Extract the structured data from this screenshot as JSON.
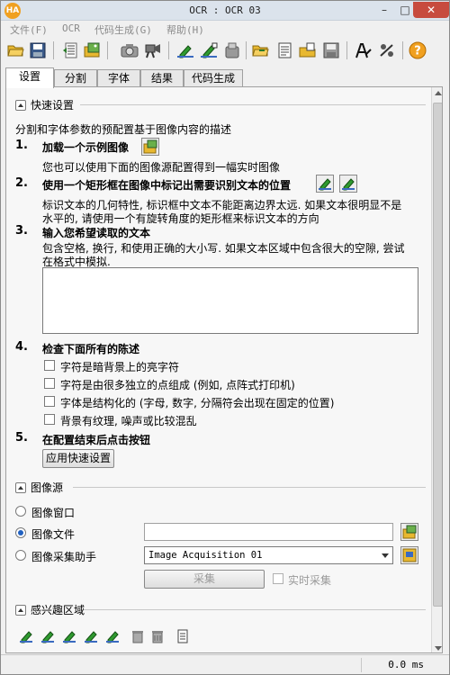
{
  "window": {
    "title": "OCR : OCR 03",
    "app_icon_text": "HA"
  },
  "menu": [
    "文件(F)",
    "OCR",
    "代码生成(G)",
    "帮助(H)"
  ],
  "toolbar": {
    "icons": [
      "open-folder-icon",
      "save-icon",
      "export-icon",
      "load-image-icon",
      "camera-icon",
      "acquisition-icon",
      "draw-pen-icon",
      "draw-pen-alt-icon",
      "read-text-icon",
      "open-project-icon",
      "document-icon",
      "import-icon",
      "save-project-icon",
      "font-a-icon",
      "settings-tools-icon",
      "help-icon"
    ],
    "help_glyph": "?"
  },
  "tabs": [
    "设置",
    "分割",
    "字体",
    "结果",
    "代码生成"
  ],
  "quick_setup": {
    "header": "快速设置",
    "intro": "分割和字体参数的预配置基于图像内容的描述",
    "step1": {
      "num": "1.",
      "title": "加载一个示例图像",
      "desc": "您也可以使用下面的图像源配置得到一幅实时图像"
    },
    "step2": {
      "num": "2.",
      "title": "使用一个矩形框在图像中标记出需要识别文本的位置",
      "desc1": "标识文本的几何特性, 标识框中文本不能距离边界太远. 如果文本很明显不是",
      "desc2": "水平的, 请使用一个有旋转角度的矩形框来标识文本的方向"
    },
    "step3": {
      "num": "3.",
      "title": "输入您希望读取的文本",
      "desc1": "包含空格, 换行, 和使用正确的大小写. 如果文本区域中包含很大的空隙, 尝试",
      "desc2": "在格式中模拟.",
      "text_value": ""
    },
    "step4": {
      "num": "4.",
      "title": "检查下面所有的陈述",
      "checks": [
        "字符是暗背景上的亮字符",
        "字符是由很多独立的点组成 (例如, 点阵式打印机)",
        "字体是结构化的 (字母, 数字, 分隔符会出现在固定的位置)",
        "背景有纹理, 噪声或比较混乱"
      ]
    },
    "step5": {
      "num": "5.",
      "title": "在配置结束后点击按钮",
      "button": "应用快速设置"
    }
  },
  "image_source": {
    "header": "图像源",
    "options": [
      "图像窗口",
      "图像文件",
      "图像采集助手"
    ],
    "selected": "图像文件",
    "file_value": "",
    "acq_value": "Image Acquisition 01",
    "acquire_button": "采集",
    "realtime_label": "实时采集"
  },
  "roi": {
    "header": "感兴趣区域",
    "icon_names": [
      "roi-draw-1-icon",
      "roi-draw-2-icon",
      "roi-draw-3-icon",
      "roi-draw-4-icon",
      "roi-draw-5-icon",
      "roi-delete-icon",
      "roi-delete-all-icon",
      "roi-list-icon"
    ]
  },
  "status": {
    "time": "0.0 ms"
  },
  "colors": {
    "accent": "#2060c0",
    "title_bar": "#dbe3ec",
    "close": "#c74b3e",
    "pen_green": "#2f9a2f",
    "folder_yellow": "#e8b830"
  }
}
